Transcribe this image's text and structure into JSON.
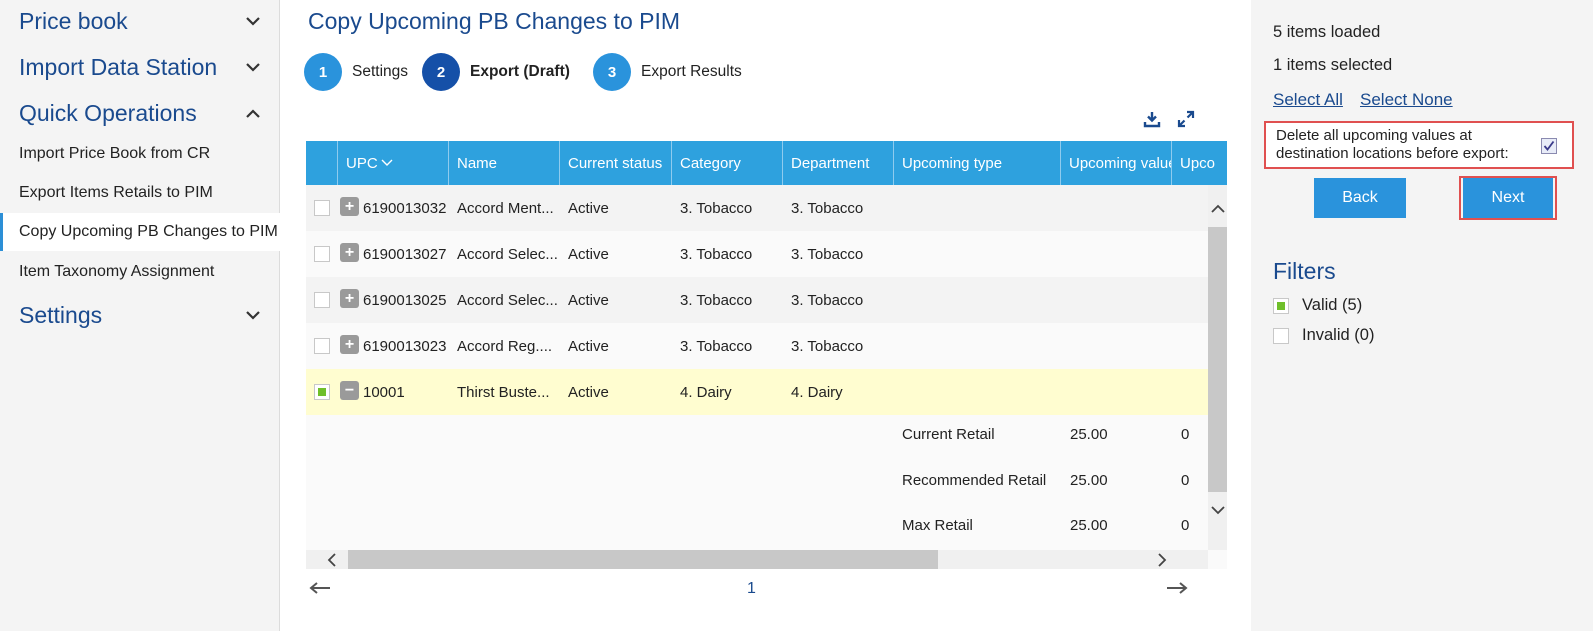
{
  "sidebar": {
    "groups": [
      {
        "label": "Price book",
        "chevron": "chevron-down-icon"
      },
      {
        "label": "Import Data Station",
        "chevron": "chevron-down-icon"
      },
      {
        "label": "Quick Operations",
        "chevron": "chevron-up-icon"
      },
      {
        "label": "Settings",
        "chevron": "chevron-down-icon"
      }
    ],
    "items": [
      {
        "label": "Import Price Book from CR"
      },
      {
        "label": "Export Items Retails to PIM"
      },
      {
        "label": "Copy Upcoming PB Changes to PIM"
      },
      {
        "label": "Item Taxonomy Assignment"
      }
    ],
    "active_item": "Copy Upcoming PB Changes to PIM"
  },
  "main": {
    "title": "Copy Upcoming PB Changes to PIM",
    "steps": [
      {
        "number": "1",
        "label": "Settings"
      },
      {
        "number": "2",
        "label": "Export (Draft)"
      },
      {
        "number": "3",
        "label": "Export Results"
      }
    ],
    "current_step": "2",
    "toolbar": {
      "download_icon": "download-icon",
      "fullscreen_icon": "expand-icon"
    }
  },
  "grid": {
    "columns": [
      "",
      "UPC",
      "Name",
      "Current status",
      "Category",
      "Department",
      "Upcoming type",
      "Upcoming value",
      "Upco"
    ],
    "sort_indicator": "chevron-down-icon",
    "rows": [
      {
        "upc": "6190013032",
        "name": "Accord Ment...",
        "status": "Active",
        "category": "3. Tobacco",
        "department": "3. Tobacco",
        "checked": false,
        "expander": "+"
      },
      {
        "upc": "6190013027",
        "name": "Accord Selec...",
        "status": "Active",
        "category": "3. Tobacco",
        "department": "3. Tobacco",
        "checked": false,
        "expander": "+"
      },
      {
        "upc": "6190013025",
        "name": "Accord Selec...",
        "status": "Active",
        "category": "3. Tobacco",
        "department": "3. Tobacco",
        "checked": false,
        "expander": "+"
      },
      {
        "upc": "6190013023",
        "name": "Accord Reg....",
        "status": "Active",
        "category": "3. Tobacco",
        "department": "3. Tobacco",
        "checked": false,
        "expander": "+"
      },
      {
        "upc": "10001",
        "name": "Thirst Buste...",
        "status": "Active",
        "category": "4. Dairy",
        "department": "4. Dairy",
        "checked": true,
        "expander": "−"
      }
    ],
    "detail_rows": [
      {
        "type": "Current Retail",
        "value": "25.00",
        "extra": "0"
      },
      {
        "type": "Recommended Retail",
        "value": "25.00",
        "extra": "0"
      },
      {
        "type": "Max Retail",
        "value": "25.00",
        "extra": "0"
      }
    ]
  },
  "pager": {
    "page": "1",
    "prev_icon": "arrow-left-icon",
    "next_icon": "arrow-right-icon"
  },
  "right_panel": {
    "items_loaded": "5 items loaded",
    "items_selected": "1 items selected",
    "select_all": "Select All",
    "select_none": "Select None",
    "delete_option": "Delete all upcoming values at destination locations before export:",
    "delete_option_checked": true,
    "back_label": "Back",
    "next_label": "Next",
    "filters_title": "Filters",
    "filters": [
      {
        "label": "Valid (5)",
        "checked": true
      },
      {
        "label": "Invalid (0)",
        "checked": false
      }
    ]
  },
  "colors": {
    "accent": "#2a93dc",
    "header_blue": "#2ea1de",
    "title_blue": "#1a4a8e",
    "current_step": "#1550a8",
    "highlight_red": "#e05050",
    "selected_row": "#fffdd0"
  }
}
